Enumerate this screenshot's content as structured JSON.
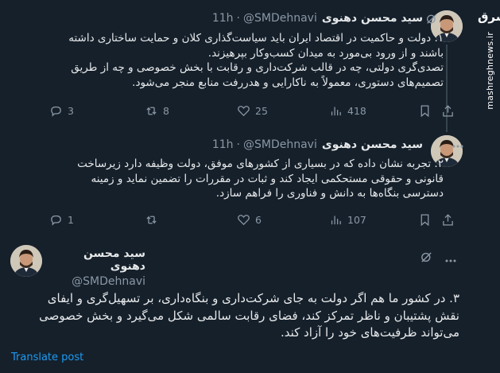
{
  "author": {
    "name": "سید محسن دهنوی",
    "handle": "@SMDehnavi"
  },
  "separator": "·",
  "watermark": {
    "logo": "مشرق",
    "site": "mashreghnews.ir"
  },
  "tweets": [
    {
      "time": "11h",
      "text": "۱. دولت و حاکمیت در اقتصاد ایران باید سیاست‌گذاری کلان و حمایت ساختاری داشته\nباشند و از ورود بی‌مورد به میدان کسب‌وکار بپرهیزند.\nتصدی‌گری دولتی، چه در قالب شرکت‌داری و رقابت با بخش خصوصی و چه از طریق\nتصمیم‌های دستوری، معمولاً به ناکارایی و هدررفت منابع منجر می‌شود.",
      "replies": "3",
      "reposts": "8",
      "likes": "25",
      "views": "418"
    },
    {
      "time": "11h",
      "text": "۲. تجربه نشان داده که در بسیاری از کشورهای موفق، دولت وظیفه دارد زیرساخت\nقانونی و حقوقی مستحکمی ایجاد کند و ثبات در مقررات را تضمین نماید و زمینه\nدسترسی بنگاه‌ها به دانش و فناوری را فراهم سازد.",
      "replies": "1",
      "reposts": "",
      "likes": "6",
      "views": "107"
    },
    {
      "text": "۳. در کشور ما هم اگر دولت به جای شرکت‌داری و بنگاه‌داری، بر تسهیل‌گری و ایفای\nنقش پشتیبان و ناظر تمرکز کند، فضای رقابت سالمی شکل می‌گیرد و بخش خصوصی\nمی‌تواند ظرفیت‌های خود را آزاد کند.",
      "translate_label": "Translate post"
    }
  ],
  "icons": {
    "grok": "grok-icon",
    "more": "more-icon",
    "reply": "reply-icon",
    "repost": "repost-icon",
    "like": "heart-icon",
    "views": "views-icon",
    "bookmark": "bookmark-icon",
    "share": "share-icon"
  },
  "colors": {
    "background": "#15202b",
    "text": "#e7e9ea",
    "muted": "#8b98a5",
    "link": "#1d9bf0",
    "thread_line": "#38444d"
  }
}
